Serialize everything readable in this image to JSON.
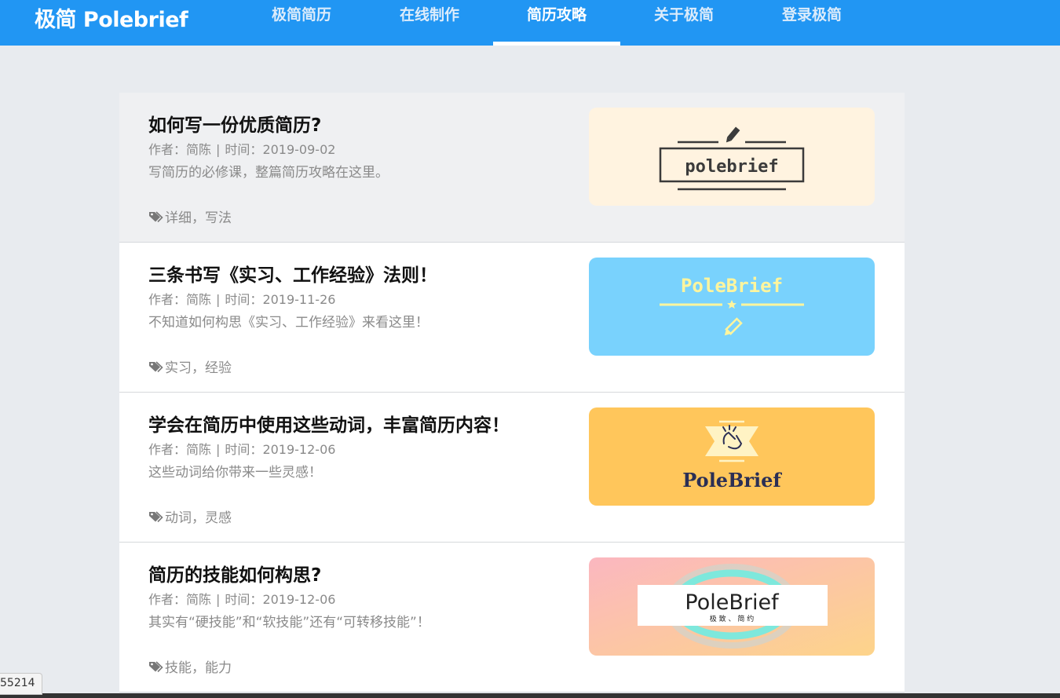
{
  "nav": {
    "brand": "极简 Polebrief",
    "items": [
      {
        "label": "极简简历"
      },
      {
        "label": "在线制作"
      },
      {
        "label": "简历攻略"
      },
      {
        "label": "关于极简"
      },
      {
        "label": "登录极简"
      }
    ],
    "active_index": 2
  },
  "articles": [
    {
      "title": "如何写一份优质简历?",
      "author_label": "作者：",
      "author": "简陈",
      "time_label": "时间：",
      "date": "2019-09-02",
      "summary": "写简历的必修课，整篇简历攻略在这里。",
      "tags": "详细，写法",
      "thumb_text": "polebrief",
      "thumb_bg": "#fff3e0"
    },
    {
      "title": "三条书写《实习、工作经验》法则！",
      "author_label": "作者：",
      "author": "简陈",
      "time_label": "时间：",
      "date": "2019-11-26",
      "summary": "不知道如何构思《实习、工作经验》来看这里！",
      "tags": "实习，经验",
      "thumb_text": "PoleBrief",
      "thumb_bg": "#79d2fd"
    },
    {
      "title": "学会在简历中使用这些动词，丰富简历内容！",
      "author_label": "作者：",
      "author": "简陈",
      "time_label": "时间：",
      "date": "2019-12-06",
      "summary": "这些动词给你带来一些灵感！",
      "tags": "动词，灵感",
      "thumb_text": "PoleBrief",
      "thumb_bg": "#ffc65b"
    },
    {
      "title": "简历的技能如何构思?",
      "author_label": "作者：",
      "author": "简陈",
      "time_label": "时间：",
      "date": "2019-12-06",
      "summary": "其实有“硬技能”和“软技能”还有“可转移技能”！",
      "tags": "技能，能力",
      "thumb_text": "PoleBrief",
      "thumb_subtext": "极 致 、 简 约",
      "thumb_bg": "#fcc49c"
    }
  ],
  "status_url": "55214",
  "colors": {
    "navbar": "#2196f3",
    "page_bg": "#e8ebef",
    "muted_text": "#8a8a8a"
  },
  "icons": [
    "tag-icon",
    "pencil-icon",
    "star-icon",
    "finger-snap-icon"
  ]
}
